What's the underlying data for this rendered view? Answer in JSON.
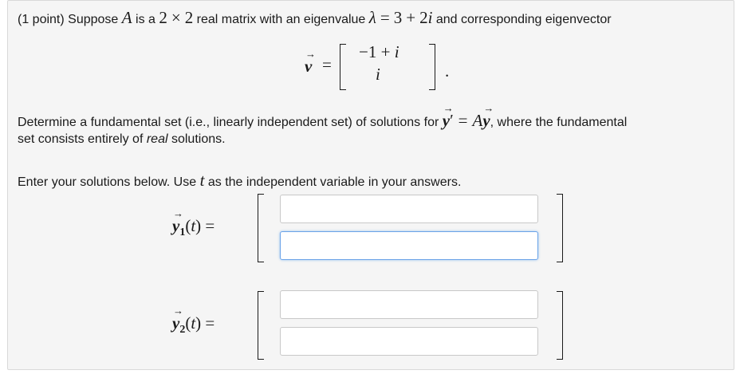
{
  "problem": {
    "points_prefix": "(1 point) Suppose ",
    "matrix_name": "A",
    "is_a": " is a ",
    "dim_n": "2",
    "times": "×",
    "dim_m": "2",
    "real_matrix_text": " real matrix with an eigenvalue ",
    "lambda": "λ",
    "equals": "=",
    "eig_real": "3",
    "plus": "+",
    "eig_imag_coeff": "2",
    "imag_unit": "i",
    "corresponding_text": " and corresponding eigenvector",
    "vector_symbol": "v",
    "vector_entry_top_a": "−1",
    "vector_entry_top_op": "+",
    "vector_entry_top_b": "i",
    "vector_entry_bottom": "i",
    "period": ".",
    "determine_text": "Determine a fundamental set (i.e., linearly independent set) of solutions for ",
    "y_symbol": "y",
    "prime": "′",
    "where_text": ", where the fundamental",
    "set_consists_text": "set consists entirely of ",
    "real_word": "real",
    "solutions_text": " solutions.",
    "enter_text_a": "Enter your solutions below. Use ",
    "t_symbol": "t",
    "enter_text_b": " as the independent variable in your answers."
  },
  "answers": {
    "y1_label_sub": "1",
    "y2_label_sub": "2",
    "arg_open": "(",
    "arg_close": ")",
    "y1_top_value": "",
    "y1_bottom_value": "",
    "y2_top_value": "",
    "y2_bottom_value": ""
  },
  "colors": {
    "panel_bg": "#f5f5f5",
    "input_focus_border": "#6aa3e8"
  }
}
